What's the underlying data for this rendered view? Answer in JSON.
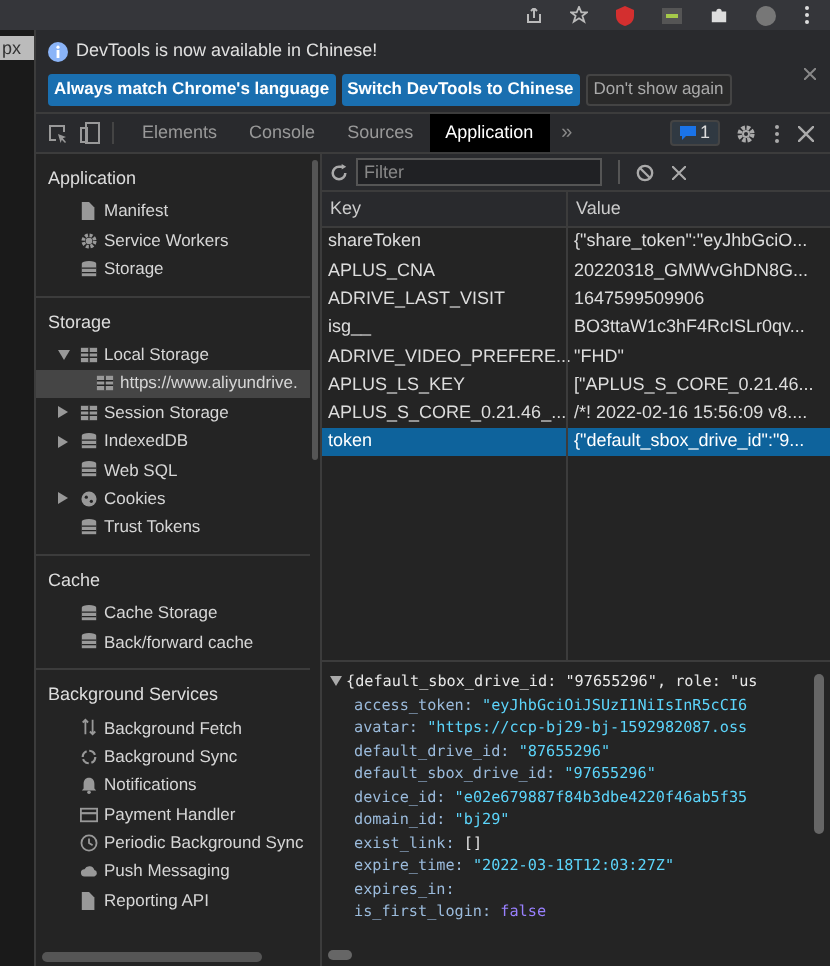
{
  "page_edge": {
    "text": "px"
  },
  "infobar": {
    "message": "DevTools is now available in Chinese!",
    "buttons": [
      {
        "label": "Always match Chrome's language",
        "kind": "primary"
      },
      {
        "label": "Switch DevTools to Chinese",
        "kind": "primary"
      },
      {
        "label": "Don't show again",
        "kind": "plain"
      }
    ]
  },
  "tabs": [
    {
      "label": "Elements",
      "selected": false
    },
    {
      "label": "Console",
      "selected": false
    },
    {
      "label": "Sources",
      "selected": false
    },
    {
      "label": "Application",
      "selected": true
    }
  ],
  "tabs_overflow": "»",
  "issues_badge": "1",
  "sidebar": [
    {
      "title": "Application",
      "items": [
        {
          "label": "Manifest",
          "kind": "file",
          "selected": false
        },
        {
          "label": "Service Workers",
          "kind": "gear",
          "selected": false
        },
        {
          "label": "Storage",
          "kind": "database",
          "selected": false
        }
      ]
    },
    {
      "title": "Storage",
      "items": [
        {
          "label": "Local Storage",
          "kind": "grid",
          "selected": false,
          "expanded": true,
          "children": [
            {
              "label": "https://www.aliyundrive.",
              "kind": "grid",
              "selected": true
            }
          ]
        },
        {
          "label": "Session Storage",
          "kind": "grid",
          "selected": false,
          "expanded": false
        },
        {
          "label": "IndexedDB",
          "kind": "database",
          "selected": false,
          "expanded": false
        },
        {
          "label": "Web SQL",
          "kind": "database",
          "selected": false
        },
        {
          "label": "Cookies",
          "kind": "cookie",
          "selected": false,
          "expanded": false
        },
        {
          "label": "Trust Tokens",
          "kind": "database",
          "selected": false
        }
      ]
    },
    {
      "title": "Cache",
      "items": [
        {
          "label": "Cache Storage",
          "kind": "database",
          "selected": false
        },
        {
          "label": "Back/forward cache",
          "kind": "database",
          "selected": false
        }
      ]
    },
    {
      "title": "Background Services",
      "items": [
        {
          "label": "Background Fetch",
          "kind": "arrows",
          "selected": false
        },
        {
          "label": "Background Sync",
          "kind": "sync",
          "selected": false
        },
        {
          "label": "Notifications",
          "kind": "bell",
          "selected": false
        },
        {
          "label": "Payment Handler",
          "kind": "card",
          "selected": false
        },
        {
          "label": "Periodic Background Sync",
          "kind": "clock",
          "selected": false
        },
        {
          "label": "Push Messaging",
          "kind": "cloud",
          "selected": false
        },
        {
          "label": "Reporting API",
          "kind": "file",
          "selected": false
        }
      ]
    }
  ],
  "filter": {
    "placeholder": "Filter"
  },
  "table": {
    "columns": [
      "Key",
      "Value"
    ],
    "rows": [
      {
        "key": "shareToken",
        "value": "{\"share_token\":\"eyJhbGciO...",
        "selected": false
      },
      {
        "key": "APLUS_CNA",
        "value": "20220318_GMWvGhDN8G...",
        "selected": false
      },
      {
        "key": "ADRIVE_LAST_VISIT",
        "value": "1647599509906",
        "selected": false
      },
      {
        "key": "isg__",
        "value": "BO3ttaW1c3hF4RcISLr0qv...",
        "selected": false
      },
      {
        "key": "ADRIVE_VIDEO_PREFERE...",
        "value": "\"FHD\"",
        "selected": false
      },
      {
        "key": "APLUS_LS_KEY",
        "value": "[\"APLUS_S_CORE_0.21.46...",
        "selected": false
      },
      {
        "key": "APLUS_S_CORE_0.21.46_...",
        "value": "/*! 2022-02-16 15:56:09 v8....",
        "selected": false
      },
      {
        "key": "token",
        "value": "{\"default_sbox_drive_id\":\"9...",
        "selected": true
      }
    ]
  },
  "preview": {
    "expanded": true,
    "summary": "{default_sbox_drive_id: \"97655296\", role: \"us",
    "entries": [
      {
        "key": "access_token:",
        "value": "\"eyJhbGciOiJSUzI1NiIsInR5cCI6",
        "kind": "string"
      },
      {
        "key": "avatar:",
        "value": "\"https://ccp-bj29-bj-1592982087.oss",
        "kind": "string"
      },
      {
        "key": "default_drive_id:",
        "value": "\"87655296\"",
        "kind": "string"
      },
      {
        "key": "default_sbox_drive_id:",
        "value": "\"97655296\"",
        "kind": "string"
      },
      {
        "key": "device_id:",
        "value": "\"e02e679887f84b3dbe4220f46ab5f35",
        "kind": "string"
      },
      {
        "key": "domain_id:",
        "value": "\"bj29\"",
        "kind": "string"
      },
      {
        "key": "exist_link:",
        "value": "[]",
        "kind": "literal"
      },
      {
        "key": "expire_time:",
        "value": "\"2022-03-18T12:03:27Z\"",
        "kind": "string"
      },
      {
        "key": "expires_in:"
      },
      {
        "key": "is_first_login:",
        "value": "false",
        "kind": "keyword"
      }
    ]
  }
}
